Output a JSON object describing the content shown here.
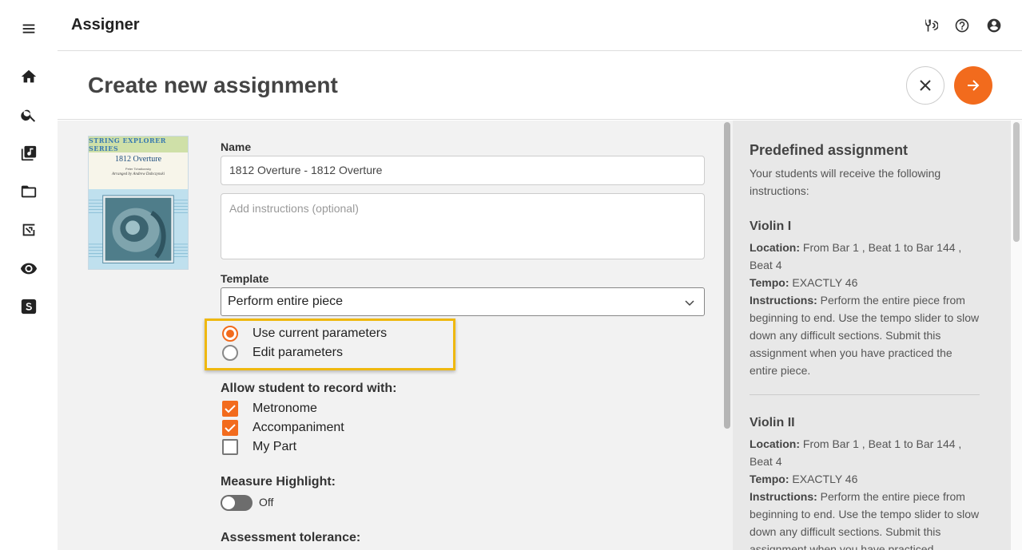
{
  "app": {
    "title": "Assigner"
  },
  "rail": {
    "items": [
      {
        "name": "menu"
      },
      {
        "name": "home"
      },
      {
        "name": "search"
      },
      {
        "name": "music-library"
      },
      {
        "name": "folder"
      },
      {
        "name": "assignments"
      },
      {
        "name": "visibility"
      },
      {
        "name": "smartmusic-logo"
      }
    ]
  },
  "header": {
    "icons": [
      "tuner-icon",
      "help-icon",
      "account-icon"
    ]
  },
  "page": {
    "title": "Create new assignment",
    "accent": "#f26b1d"
  },
  "cover": {
    "series": "STRING EXPLORER SERIES",
    "title": "1812 Overture",
    "composer": "Peter Tchaikovsky",
    "arranger": "Arranged by Andrew Dabczynski"
  },
  "form": {
    "name_label": "Name",
    "name_value": "1812 Overture - 1812 Overture",
    "instructions_placeholder": "Add instructions (optional)",
    "template_label": "Template",
    "template_value": "Perform entire piece",
    "params": {
      "use_current": "Use current parameters",
      "edit": "Edit parameters",
      "selected": "use_current"
    },
    "record_label": "Allow student to record with:",
    "record_options": {
      "metronome": "Metronome",
      "accompaniment": "Accompaniment",
      "my_part": "My Part"
    },
    "measure_highlight_label": "Measure Highlight:",
    "measure_highlight_value": "Off",
    "assessment_label": "Assessment tolerance:"
  },
  "side": {
    "title": "Predefined assignment",
    "intro": "Your students will receive the following instructions:",
    "location_label": "Location:",
    "tempo_label": "Tempo:",
    "instructions_label": "Instructions:",
    "parts": [
      {
        "name": "Violin I",
        "location": "From Bar 1 , Beat 1 to Bar 144 , Beat 4",
        "tempo": "EXACTLY 46",
        "instructions": "Perform the entire piece from beginning to end. Use the tempo slider to slow down any difficult sections. Submit this assignment when you have practiced the entire piece."
      },
      {
        "name": "Violin II",
        "location": "From Bar 1 , Beat 1 to Bar 144 , Beat 4",
        "tempo": "EXACTLY 46",
        "instructions": "Perform the entire piece from beginning to end. Use the tempo slider to slow down any difficult sections. Submit this assignment when you have practiced"
      }
    ]
  }
}
